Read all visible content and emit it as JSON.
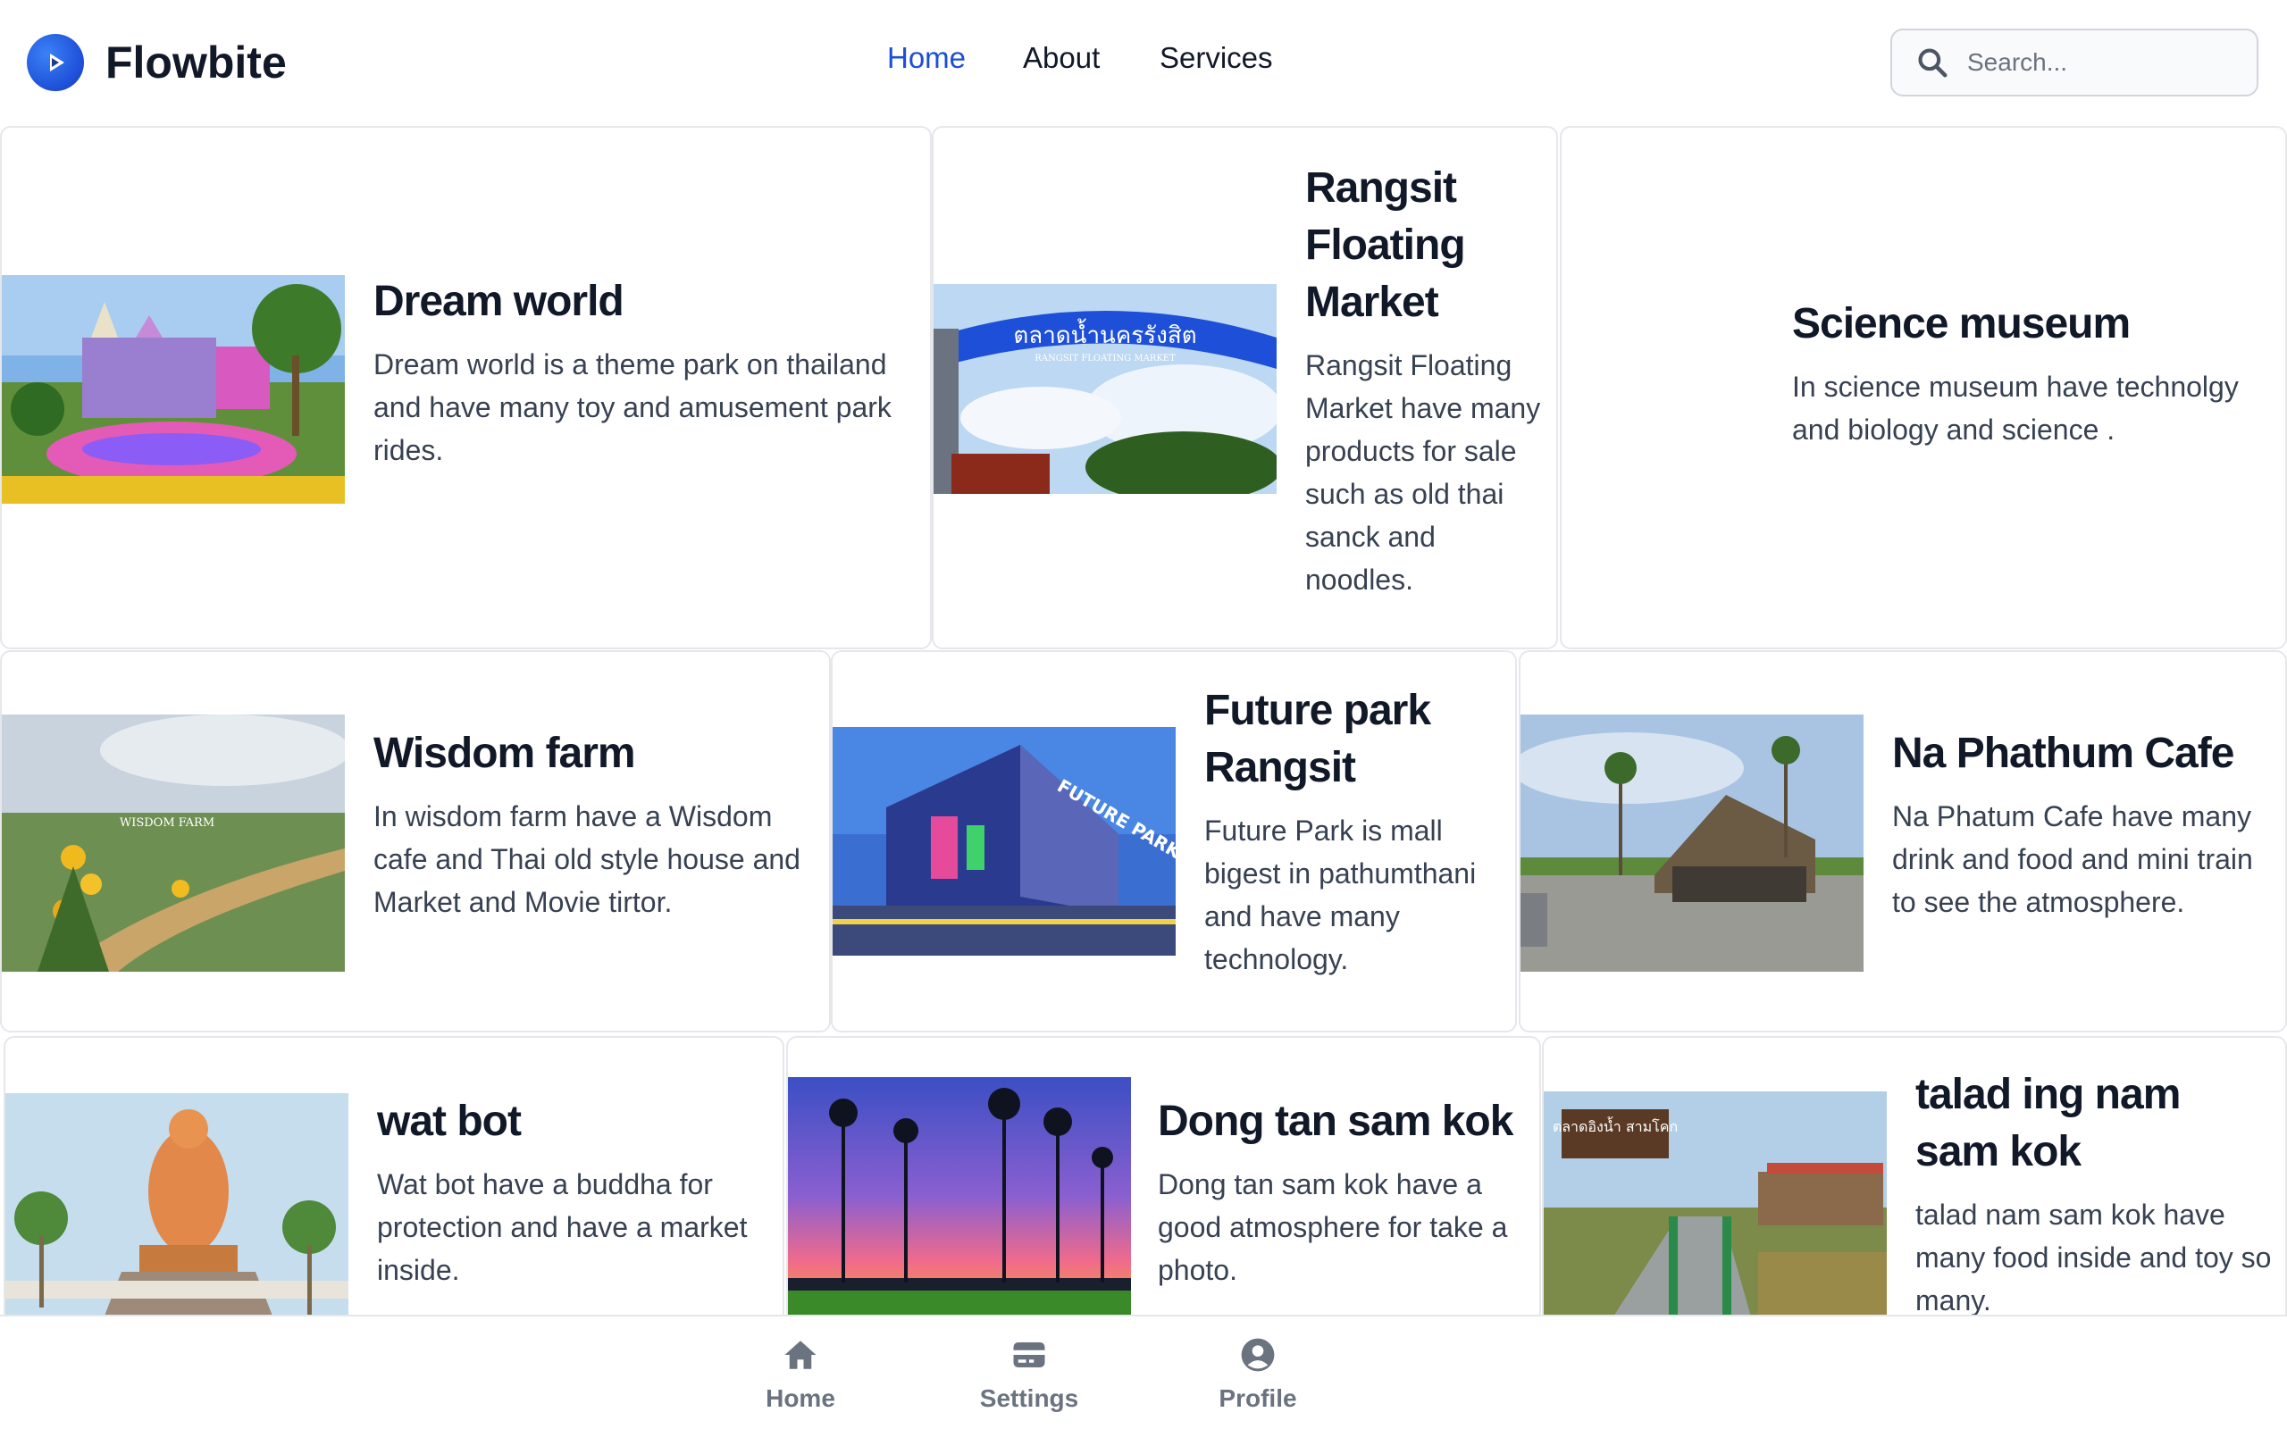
{
  "brand": {
    "name": "Flowbite",
    "accent": "#1d4ed8"
  },
  "nav": {
    "items": [
      {
        "label": "Home",
        "active": true
      },
      {
        "label": "About",
        "active": false
      },
      {
        "label": "Services",
        "active": false
      }
    ]
  },
  "search": {
    "placeholder": "Search..."
  },
  "cards": [
    {
      "title": "Dream world",
      "body": "Dream world is a theme park on thailand and have many toy and amusement park rides."
    },
    {
      "title": "Rangsit Floating Market",
      "body": "Rangsit Floating Market have many products for sale such as old thai sanck and noodles.",
      "sign_text": "ตลาดน้ำนครรังสิต",
      "sign_subtext": "RANGSIT FLOATING MARKET"
    },
    {
      "title": "Science museum",
      "body": "In science museum have technolgy and biology and science ."
    },
    {
      "title": "Wisdom farm",
      "body": "In wisdom farm have a Wisdom cafe and Thai old style house and Market and Movie tirtor.",
      "sign_text": "WISDOM FARM"
    },
    {
      "title": "Future park Rangsit",
      "body": "Future Park is mall bigest in pathumthani and have many technology.",
      "sign_text": "FUTURE PARK"
    },
    {
      "title": "Na Phathum Cafe",
      "body": "Na Phatum Cafe have many drink and food and mini train to see the atmosphere."
    },
    {
      "title": "wat bot",
      "body": "Wat bot have a buddha for protection and have a market inside."
    },
    {
      "title": "Dong tan sam kok",
      "body": "Dong tan sam kok have a good atmosphere for take a photo."
    },
    {
      "title": "talad ing nam sam kok",
      "body": "talad nam sam kok have many food inside and toy so many.",
      "sign_text": "ตลาดอิงน้ำ สามโคก"
    }
  ],
  "bottom_nav": {
    "items": [
      {
        "label": "Home",
        "icon": "home-icon"
      },
      {
        "label": "Settings",
        "icon": "credit-card-icon"
      },
      {
        "label": "Profile",
        "icon": "user-circle-icon"
      }
    ]
  }
}
